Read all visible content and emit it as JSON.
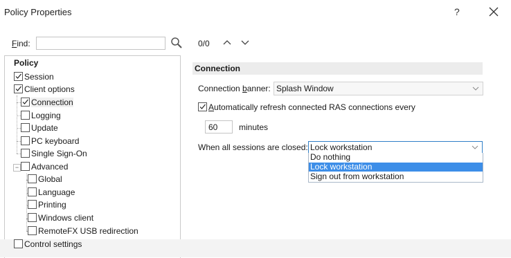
{
  "window": {
    "title": "Policy Properties",
    "help": "?"
  },
  "find": {
    "label_pre": "",
    "label_accel": "F",
    "label_post": "ind:",
    "value": "",
    "count": "0/0"
  },
  "tree": {
    "header": "Policy",
    "items": [
      {
        "label": "Session",
        "checked": true
      },
      {
        "label": "Client options",
        "checked": true
      },
      {
        "label": "Connection",
        "checked": true
      },
      {
        "label": "Logging",
        "checked": false
      },
      {
        "label": "Update",
        "checked": false
      },
      {
        "label": "PC keyboard",
        "checked": false
      },
      {
        "label": "Single Sign-On",
        "checked": false
      },
      {
        "label": "Advanced",
        "checked": false,
        "expander": "−"
      },
      {
        "label": "Global",
        "checked": false
      },
      {
        "label": "Language",
        "checked": false
      },
      {
        "label": "Printing",
        "checked": false
      },
      {
        "label": "Windows client",
        "checked": false
      },
      {
        "label": "RemoteFX USB redirection",
        "checked": false
      },
      {
        "label": "Control settings",
        "checked": false
      }
    ]
  },
  "connection": {
    "section_title": "Connection",
    "banner_label_pre": "Connection ",
    "banner_label_accel": "b",
    "banner_label_post": "anner:",
    "banner_value": "Splash Window",
    "auto_refresh_pre": "",
    "auto_refresh_accel": "A",
    "auto_refresh_post": "utomatically refresh connected RAS connections every",
    "auto_refresh_checked": true,
    "minutes_value": "60",
    "minutes_label": "minutes",
    "sessions_closed_label": "When all sessions are closed:",
    "sessions_closed_value": "Lock workstation",
    "sessions_closed_options": [
      "Do nothing",
      "Lock workstation",
      "Sign out from workstation"
    ],
    "sessions_closed_selected_index": 1
  },
  "colors": {
    "selection": "#3d8ee8",
    "focus_border": "#2f7fc8",
    "section_bg": "#ececec"
  }
}
